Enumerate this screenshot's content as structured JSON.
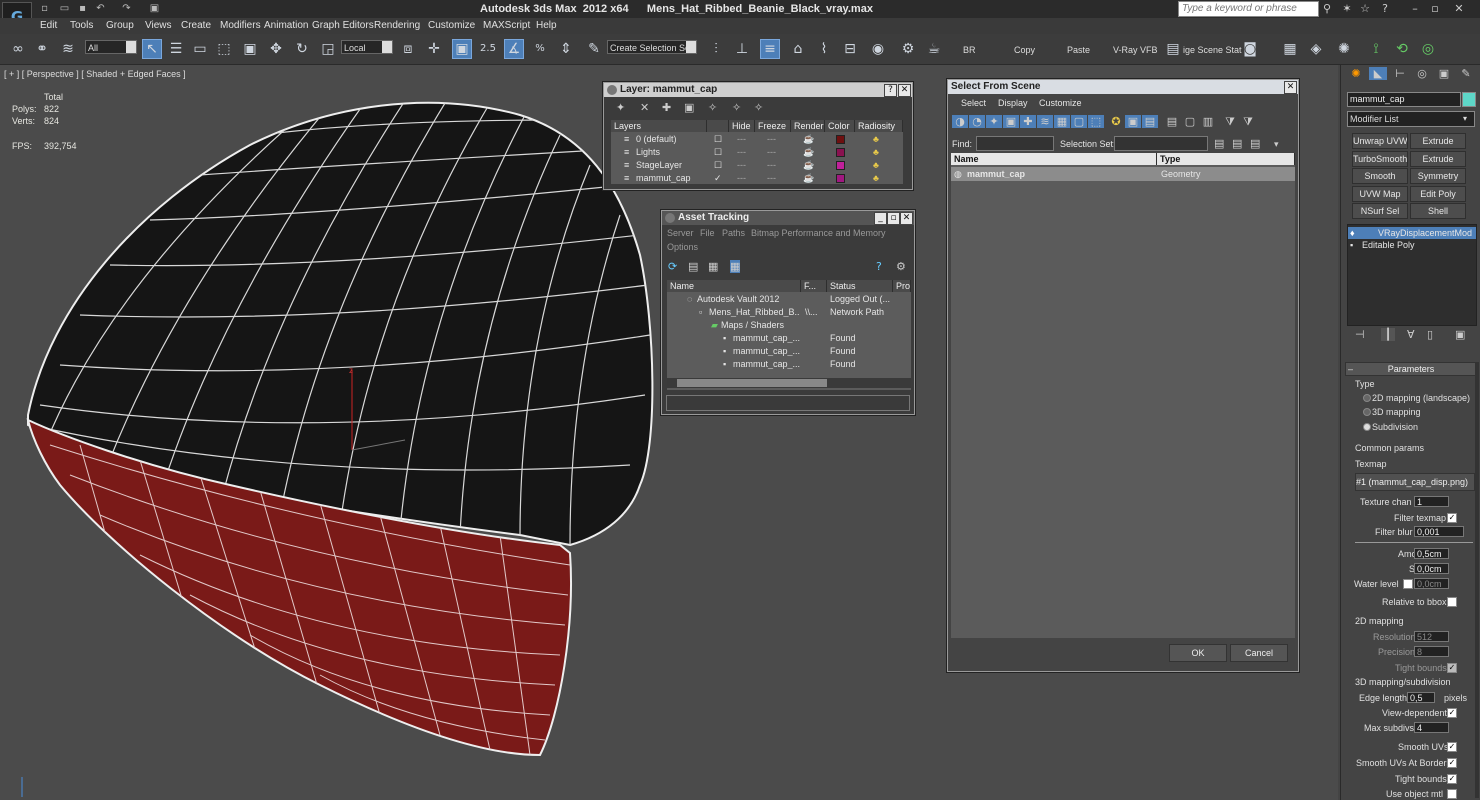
{
  "window": {
    "title": "Autodesk 3ds Max  2012 x64      Mens_Hat_Ribbed_Beanie_Black_vray.max",
    "search_placeholder": "Type a keyword or phrase"
  },
  "menu": [
    "Edit",
    "Tools",
    "Group",
    "Views",
    "Create",
    "Modifiers",
    "Animation",
    "Graph Editors",
    "Rendering",
    "Customize",
    "MAXScript",
    "Help"
  ],
  "toolbar": {
    "filter": "All",
    "coord": "Local",
    "selection_set_placeholder": "Create Selection Se",
    "snap_label": "2.5",
    "br": "BR",
    "copy": "Copy",
    "paste": "Paste",
    "vrayfb": "V-Ray VFB",
    "scene_state": "ige Scene Stat"
  },
  "viewport": {
    "label": "[ + ] [ Perspective ] [ Shaded + Edged Faces ]",
    "stats": {
      "total": "Total",
      "polys_label": "Polys:",
      "polys": "822",
      "verts_label": "Verts:",
      "verts": "824",
      "fps_label": "FPS:",
      "fps": "392,754"
    },
    "axis_z": "z"
  },
  "layer_window": {
    "title": "Layer: mammut_cap",
    "columns": [
      "Layers",
      "",
      "Hide",
      "Freeze",
      "Render",
      "Color",
      "Radiosity"
    ],
    "rows": [
      {
        "name": "0 (default)",
        "color": "#6e1010"
      },
      {
        "name": "Lights",
        "color": "#8a1250"
      },
      {
        "name": "StageLayer",
        "color": "#c0209a"
      },
      {
        "name": "mammut_cap",
        "color": "#a01880"
      }
    ]
  },
  "asset_window": {
    "title": "Asset Tracking",
    "menu": [
      "Server",
      "File",
      "Paths",
      "Bitmap Performance and Memory"
    ],
    "menu2": "Options",
    "columns": [
      "Name",
      "F...",
      "Status",
      "Pro"
    ],
    "rows": [
      {
        "name": "Autodesk Vault 2012",
        "f": "",
        "status": "Logged Out (..."
      },
      {
        "name": "Mens_Hat_Ribbed_B...",
        "f": "\\\\...",
        "status": "Network Path"
      },
      {
        "name": "Maps / Shaders",
        "f": "",
        "status": ""
      },
      {
        "name": "mammut_cap_...",
        "f": "",
        "status": "Found"
      },
      {
        "name": "mammut_cap_...",
        "f": "",
        "status": "Found"
      },
      {
        "name": "mammut_cap_...",
        "f": "",
        "status": "Found"
      }
    ]
  },
  "select_window": {
    "title": "Select From Scene",
    "menu": [
      "Select",
      "Display",
      "Customize"
    ],
    "find_label": "Find:",
    "selset_label": "Selection Set:",
    "columns": [
      "Name",
      "Type"
    ],
    "rows": [
      {
        "name": "mammut_cap",
        "type": "Geometry"
      }
    ],
    "ok": "OK",
    "cancel": "Cancel"
  },
  "command_panel": {
    "object_name": "mammut_cap",
    "object_color": "#5ed7c8",
    "modifier_list": "Modifier List",
    "mod_buttons": [
      "Unwrap UVW",
      "Extrude",
      "TurboSmooth",
      "Extrude",
      "Smooth",
      "Symmetry",
      "UVW Map",
      "Edit Poly",
      "NSurf Sel",
      "Shell"
    ],
    "stack": [
      "VRayDisplacementMod",
      "Editable Poly"
    ],
    "rollout": "Parameters",
    "type_label": "Type",
    "type_options": [
      "2D mapping (landscape)",
      "3D mapping",
      "Subdivision"
    ],
    "common_params": "Common params",
    "texmap_label": "Texmap",
    "texmap_value": "#1 (mammut_cap_disp.png)",
    "texture_chan_label": "Texture chan",
    "texture_chan": "1",
    "filter_texmap": "Filter texmap",
    "filter_blur_label": "Filter blur",
    "filter_blur": "0,001",
    "amount_label": "Amount",
    "amount": "0,5cm",
    "shift_label": "Shift",
    "shift": "0,0cm",
    "water_level_label": "Water level",
    "water_level": "0,0cm",
    "relative_bbox": "Relative to bbox",
    "mapping2d": "2D mapping",
    "resolution_label": "Resolution",
    "resolution": "512",
    "precision_label": "Precision",
    "precision": "8",
    "tight_bounds": "Tight bounds",
    "mapping3d": "3D mapping/subdivision",
    "edge_length_label": "Edge length",
    "edge_length": "0,5",
    "pixels": "pixels",
    "view_dependent": "View-dependent",
    "max_subdivs_label": "Max subdivs",
    "max_subdivs": "4",
    "smooth_uvs": "Smooth UVs",
    "smooth_uvs_borders": "Smooth UVs At Borders",
    "tight_bounds2": "Tight bounds",
    "use_object_mtl": "Use object mtl"
  }
}
